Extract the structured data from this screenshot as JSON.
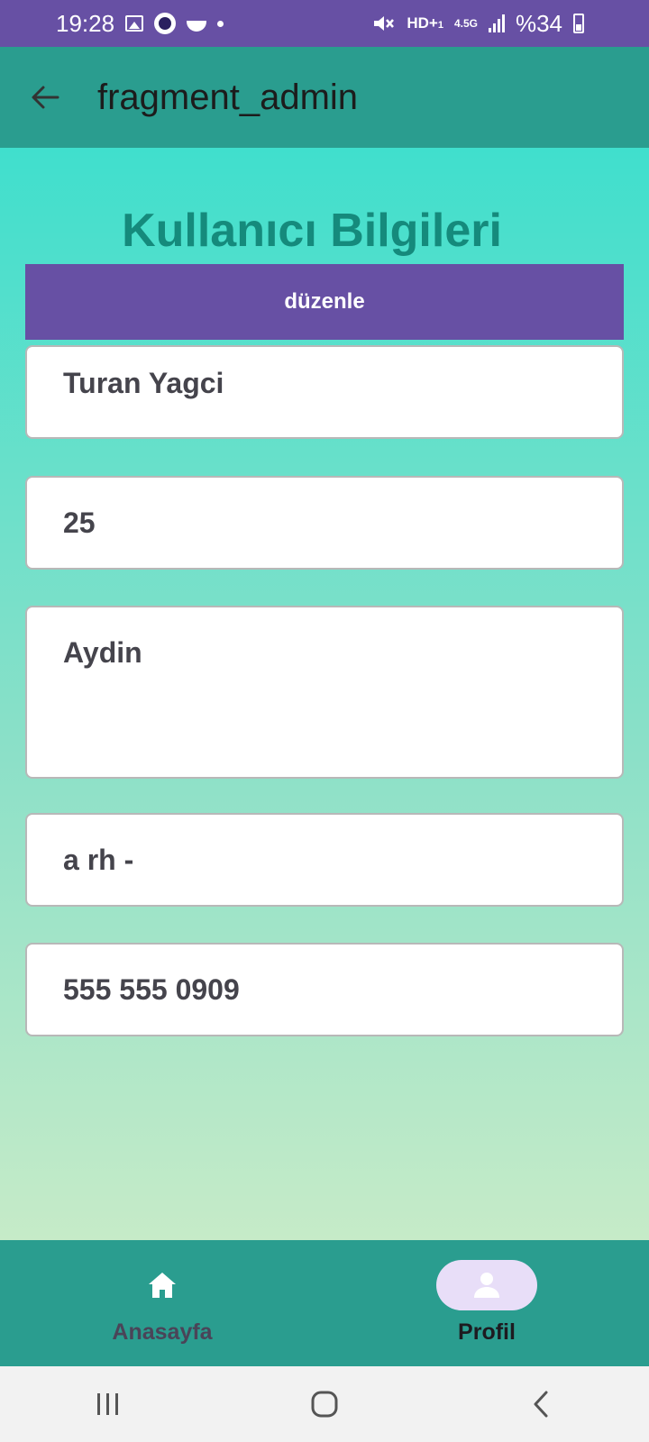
{
  "status_bar": {
    "time": "19:28",
    "network_label": "HD+",
    "network_sub": "1",
    "network_type": "4.5G",
    "battery_text": "%34"
  },
  "app_bar": {
    "title": "fragment_admin"
  },
  "profile": {
    "heading": "Kullanıcı Bilgileri",
    "edit_label": "düzenle",
    "name": "Turan Yagci",
    "age": "25",
    "city": "Aydin",
    "blood_type": "a rh -",
    "phone": "555 555 0909"
  },
  "bottom_nav": {
    "items": [
      {
        "label": "Anasayfa",
        "icon": "home-icon",
        "active": false
      },
      {
        "label": "Profil",
        "icon": "person-icon",
        "active": true
      }
    ]
  },
  "colors": {
    "status_bar": "#6750a4",
    "app_bar": "#2a9d8f",
    "heading": "#158a7c",
    "button": "#6750a4",
    "active_indicator": "#e8def8"
  }
}
